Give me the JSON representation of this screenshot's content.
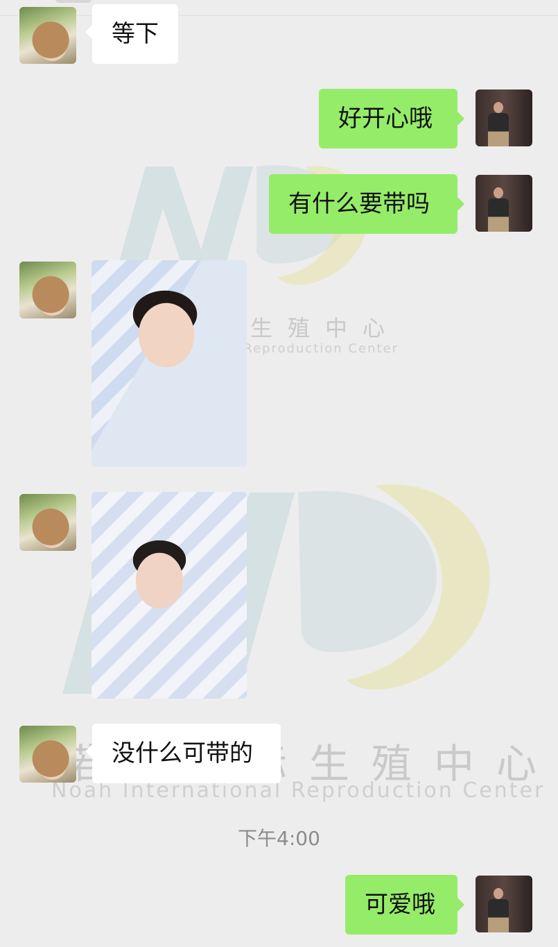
{
  "watermark": {
    "cn": "诺亚国际生殖中心",
    "en": "Noah International Reproduction Center",
    "logo_text": "NR"
  },
  "messages": [
    {
      "side": "left",
      "type": "text",
      "text": "等下"
    },
    {
      "side": "right",
      "type": "text",
      "text": "好开心哦"
    },
    {
      "side": "right",
      "type": "text",
      "text": "有什么要带吗"
    },
    {
      "side": "left",
      "type": "image",
      "desc": ""
    },
    {
      "side": "left",
      "type": "image",
      "desc": ""
    },
    {
      "side": "left",
      "type": "text",
      "text": "没什么可带的"
    },
    {
      "type": "timestamp",
      "text": "下午4:00"
    },
    {
      "side": "right",
      "type": "text",
      "text": "可爱哦"
    }
  ],
  "colors": {
    "background": "#ededed",
    "incoming_bubble": "#ffffff",
    "outgoing_bubble": "#95ec69",
    "timestamp_text": "#8c8c8c"
  },
  "icons": {
    "incoming_avatar": "avatar-woman",
    "outgoing_avatar": "avatar-man"
  }
}
